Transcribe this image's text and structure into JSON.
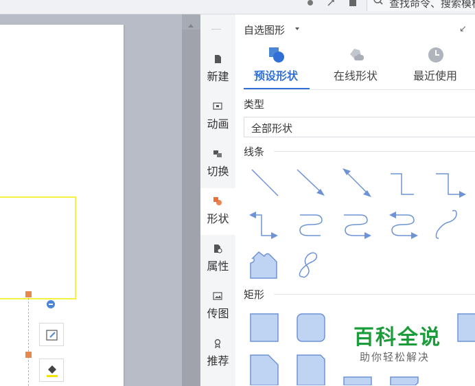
{
  "toolbar": {
    "search_placeholder": "查找命令、搜索模板"
  },
  "rail": {
    "items": [
      {
        "label": "新建",
        "icon": "new-doc-icon"
      },
      {
        "label": "动画",
        "icon": "animation-icon"
      },
      {
        "label": "切换",
        "icon": "transition-icon"
      },
      {
        "label": "形状",
        "icon": "shapes-icon"
      },
      {
        "label": "属性",
        "icon": "properties-icon"
      },
      {
        "label": "传图",
        "icon": "upload-image-icon"
      },
      {
        "label": "推荐",
        "icon": "recommend-icon"
      }
    ]
  },
  "panel": {
    "title": "自选图形",
    "tabs": [
      {
        "label": "预设形状",
        "icon": "preset-shapes-icon"
      },
      {
        "label": "在线形状",
        "icon": "online-shapes-icon"
      },
      {
        "label": "最近使用",
        "icon": "clock-icon"
      }
    ],
    "type_label": "类型",
    "type_value": "全部形状",
    "sections": {
      "lines": "线条",
      "rect": "矩形"
    }
  },
  "watermark": {
    "title": "百科全说",
    "subtitle": "助你轻松解决"
  },
  "colors": {
    "accent": "#2f6fd6",
    "shape_fill": "#bfd3f3",
    "shape_stroke": "#6d93d6",
    "watermark": "#1a9c3a"
  }
}
